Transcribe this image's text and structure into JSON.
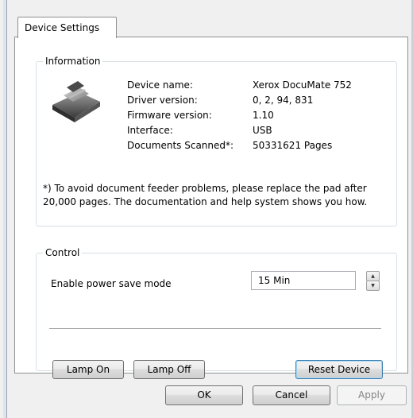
{
  "tab": {
    "label": "Device Settings"
  },
  "information": {
    "legend": "Information",
    "rows": [
      {
        "label": "Device name:",
        "value": "Xerox DocuMate 752"
      },
      {
        "label": "Driver version:",
        "value": "0, 2, 94, 831"
      },
      {
        "label": "Firmware version:",
        "value": "1.10"
      },
      {
        "label": "Interface:",
        "value": "USB"
      },
      {
        "label": "Documents Scanned*:",
        "value": "50331621 Pages"
      }
    ],
    "note": "*) To avoid document feeder problems, please replace the pad after 20,000 pages. The documentation and help system shows you how.",
    "device_icon": "scanner-icon"
  },
  "control": {
    "legend": "Control",
    "power_save_label": "Enable power save mode",
    "power_save_value": "15 Min",
    "lamp_on": "Lamp On",
    "lamp_off": "Lamp Off",
    "reset_device": "Reset Device"
  },
  "footer": {
    "ok": "OK",
    "cancel": "Cancel",
    "apply": "Apply"
  },
  "colors": {
    "default_button_border": "#3c7fb1",
    "group_border": "#d5dfe5"
  }
}
